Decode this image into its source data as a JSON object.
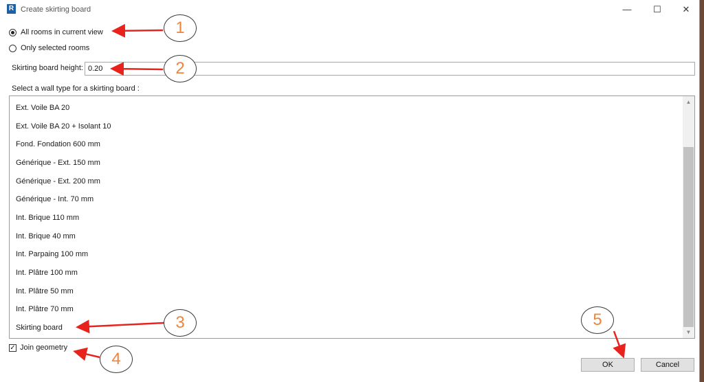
{
  "window": {
    "title": "Create skirting board",
    "app_icon": "R",
    "controls": {
      "minimize": "—",
      "maximize": "☐",
      "close": "✕"
    }
  },
  "scope": {
    "options": [
      {
        "label": "All rooms in current view",
        "checked": true
      },
      {
        "label": "Only selected rooms",
        "checked": false
      }
    ]
  },
  "height": {
    "label": "Skirting board height:",
    "value": "0.20"
  },
  "wall_types": {
    "label": "Select a wall type for a skirting board :",
    "items": [
      "Ext. Voile BA 20",
      "Ext. Voile BA 20 + Isolant 10",
      "Fond. Fondation 600 mm",
      "Générique - Ext. 150 mm",
      "Générique - Ext. 200 mm",
      "Générique - Int. 70 mm",
      "Int. Brique 110 mm",
      "Int. Brique 40 mm",
      "Int. Parpaing 100 mm",
      "Int. Plâtre 100 mm",
      "Int. Plâtre 50 mm",
      "Int. Plâtre 70 mm",
      "Skirting board"
    ]
  },
  "join_geometry": {
    "label": "Join geometry",
    "checked": true
  },
  "buttons": {
    "ok": "OK",
    "cancel": "Cancel"
  },
  "callouts": [
    "1",
    "2",
    "3",
    "4",
    "5"
  ],
  "colors": {
    "arrow": "#e8221c",
    "callout_text": "#f0843a",
    "app_icon": "#1f5fa8"
  }
}
